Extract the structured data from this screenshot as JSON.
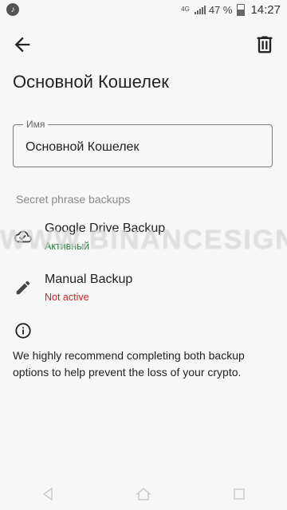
{
  "status_bar": {
    "network": "4G",
    "battery": "47 %",
    "time": "14:27"
  },
  "wallet": {
    "title": "Основной Кошелек",
    "name_field": {
      "label": "Имя",
      "value": "Основной Кошелек"
    }
  },
  "backups": {
    "section_title": "Secret phrase backups",
    "google": {
      "title": "Google Drive Backup",
      "status": "Активный",
      "icon": "cloud-check-icon"
    },
    "manual": {
      "title": "Manual Backup",
      "status": "Not active",
      "icon": "pencil-icon"
    }
  },
  "info": {
    "icon": "info-icon",
    "text": "We highly recommend completing both backup options to help prevent the loss of your crypto."
  },
  "watermark": "WWW.BINANCESIGNALS.COM",
  "colors": {
    "active": "#1e7d34",
    "inactive": "#c62828",
    "background": "#f7f7f7"
  }
}
